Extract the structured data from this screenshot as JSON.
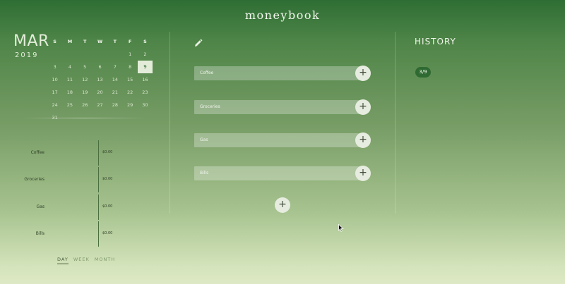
{
  "app": {
    "title": "moneybook"
  },
  "calendar": {
    "month": "MAR",
    "year": "2019",
    "weekdays": [
      "S",
      "M",
      "T",
      "W",
      "T",
      "F",
      "S"
    ],
    "weeks": [
      [
        "",
        "",
        "",
        "",
        "",
        "1",
        "2"
      ],
      [
        "3",
        "4",
        "5",
        "6",
        "7",
        "8",
        "9"
      ],
      [
        "10",
        "11",
        "12",
        "13",
        "14",
        "15",
        "16"
      ],
      [
        "17",
        "18",
        "19",
        "20",
        "21",
        "22",
        "23"
      ],
      [
        "24",
        "25",
        "26",
        "27",
        "28",
        "29",
        "30"
      ],
      [
        "31",
        "",
        "",
        "",
        "",
        "",
        ""
      ]
    ],
    "selected_day": "9"
  },
  "summary": {
    "items": [
      {
        "label": "Coffee",
        "amount": "$0.00"
      },
      {
        "label": "Groceries",
        "amount": "$0.00"
      },
      {
        "label": "Gas",
        "amount": "$0.00"
      },
      {
        "label": "Bills",
        "amount": "$0.00"
      }
    ],
    "periods": [
      {
        "label": "DAY",
        "active": true
      },
      {
        "label": "WEEK",
        "active": false
      },
      {
        "label": "MONTH",
        "active": false
      }
    ]
  },
  "categories": {
    "edit_icon": "pencil-icon",
    "items": [
      {
        "label": "Coffee",
        "add_symbol": "+"
      },
      {
        "label": "Groceries",
        "add_symbol": "+"
      },
      {
        "label": "Gas",
        "add_symbol": "+"
      },
      {
        "label": "Bills",
        "add_symbol": "+"
      }
    ],
    "add_category_symbol": "+"
  },
  "history": {
    "title": "HISTORY",
    "entries": [
      "3/9"
    ]
  },
  "colors": {
    "brand_green": "#2f6a32",
    "accent_light": "#e3ecd9"
  }
}
